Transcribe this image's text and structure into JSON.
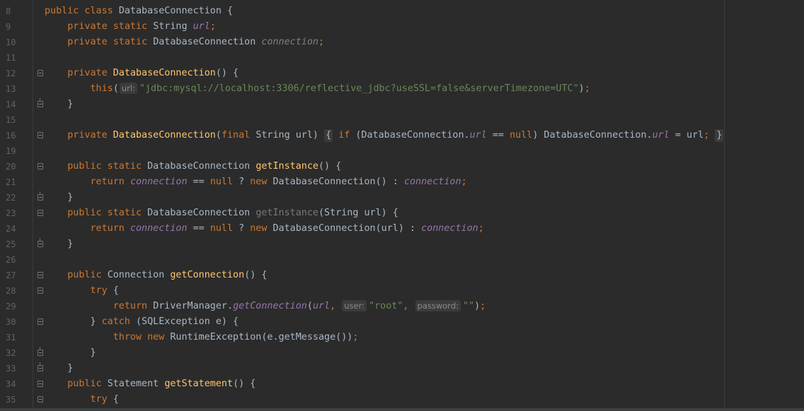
{
  "editor": {
    "lines": [
      {
        "num": "8",
        "tokens": [
          {
            "t": "kw",
            "v": "public class "
          },
          {
            "t": "pl",
            "v": "DatabaseConnection {"
          }
        ]
      },
      {
        "num": "9",
        "tokens": [
          {
            "t": "pl",
            "v": "    "
          },
          {
            "t": "kw",
            "v": "private static "
          },
          {
            "t": "pl",
            "v": "String "
          },
          {
            "t": "fld",
            "v": "url"
          },
          {
            "t": "kw",
            "v": ";"
          }
        ]
      },
      {
        "num": "10",
        "tokens": [
          {
            "t": "pl",
            "v": "    "
          },
          {
            "t": "kw",
            "v": "private static "
          },
          {
            "t": "pl",
            "v": "DatabaseConnection "
          },
          {
            "t": "fldg",
            "v": "connection"
          },
          {
            "t": "kw",
            "v": ";"
          }
        ]
      },
      {
        "num": "11",
        "tokens": []
      },
      {
        "num": "12",
        "fold": "start",
        "tokens": [
          {
            "t": "pl",
            "v": "    "
          },
          {
            "t": "kw",
            "v": "private "
          },
          {
            "t": "fn",
            "v": "DatabaseConnection"
          },
          {
            "t": "pl",
            "v": "() {"
          }
        ]
      },
      {
        "num": "13",
        "tokens": [
          {
            "t": "pl",
            "v": "        "
          },
          {
            "t": "kw",
            "v": "this"
          },
          {
            "t": "pl",
            "v": "("
          },
          {
            "t": "hint",
            "v": "url:"
          },
          {
            "t": "str",
            "v": "\"jdbc:mysql://localhost:3306/reflective_jdbc?useSSL=false&serverTimezone=UTC\""
          },
          {
            "t": "pl",
            "v": ")"
          },
          {
            "t": "kw",
            "v": ";"
          }
        ]
      },
      {
        "num": "14",
        "fold": "end",
        "tokens": [
          {
            "t": "pl",
            "v": "    }"
          }
        ]
      },
      {
        "num": "15",
        "tokens": []
      },
      {
        "num": "16",
        "fold": "start",
        "tokens": [
          {
            "t": "pl",
            "v": "    "
          },
          {
            "t": "kw",
            "v": "private "
          },
          {
            "t": "fn",
            "v": "DatabaseConnection"
          },
          {
            "t": "pl",
            "v": "("
          },
          {
            "t": "kw",
            "v": "final "
          },
          {
            "t": "pl",
            "v": "String url) "
          },
          {
            "t": "box",
            "v": "{"
          },
          {
            "t": "pl",
            "v": " "
          },
          {
            "t": "kw",
            "v": "if "
          },
          {
            "t": "pl",
            "v": "(DatabaseConnection."
          },
          {
            "t": "fld",
            "v": "url"
          },
          {
            "t": "pl",
            "v": " == "
          },
          {
            "t": "kw",
            "v": "null"
          },
          {
            "t": "pl",
            "v": ") DatabaseConnection."
          },
          {
            "t": "fld",
            "v": "url"
          },
          {
            "t": "pl",
            "v": " = url"
          },
          {
            "t": "kw",
            "v": ";"
          },
          {
            "t": "pl",
            "v": " "
          },
          {
            "t": "box",
            "v": "}"
          }
        ]
      },
      {
        "num": "19",
        "tokens": []
      },
      {
        "num": "20",
        "fold": "start",
        "tokens": [
          {
            "t": "pl",
            "v": "    "
          },
          {
            "t": "kw",
            "v": "public static "
          },
          {
            "t": "pl",
            "v": "DatabaseConnection "
          },
          {
            "t": "fn",
            "v": "getInstance"
          },
          {
            "t": "pl",
            "v": "() {"
          }
        ]
      },
      {
        "num": "21",
        "tokens": [
          {
            "t": "pl",
            "v": "        "
          },
          {
            "t": "kw",
            "v": "return "
          },
          {
            "t": "fld",
            "v": "connection"
          },
          {
            "t": "pl",
            "v": " == "
          },
          {
            "t": "kw",
            "v": "null "
          },
          {
            "t": "pl",
            "v": "? "
          },
          {
            "t": "kw",
            "v": "new "
          },
          {
            "t": "pl",
            "v": "DatabaseConnection() : "
          },
          {
            "t": "fld",
            "v": "connection"
          },
          {
            "t": "kw",
            "v": ";"
          }
        ]
      },
      {
        "num": "22",
        "fold": "end",
        "tokens": [
          {
            "t": "pl",
            "v": "    }"
          }
        ]
      },
      {
        "num": "23",
        "fold": "start",
        "tokens": [
          {
            "t": "pl",
            "v": "    "
          },
          {
            "t": "kw",
            "v": "public static "
          },
          {
            "t": "pl",
            "v": "DatabaseConnection "
          },
          {
            "t": "gray",
            "v": "getInstance"
          },
          {
            "t": "pl",
            "v": "(String url) {"
          }
        ]
      },
      {
        "num": "24",
        "tokens": [
          {
            "t": "pl",
            "v": "        "
          },
          {
            "t": "kw",
            "v": "return "
          },
          {
            "t": "fld",
            "v": "connection"
          },
          {
            "t": "pl",
            "v": " == "
          },
          {
            "t": "kw",
            "v": "null "
          },
          {
            "t": "pl",
            "v": "? "
          },
          {
            "t": "kw",
            "v": "new "
          },
          {
            "t": "pl",
            "v": "DatabaseConnection(url) : "
          },
          {
            "t": "fld",
            "v": "connection"
          },
          {
            "t": "kw",
            "v": ";"
          }
        ]
      },
      {
        "num": "25",
        "fold": "end",
        "tokens": [
          {
            "t": "pl",
            "v": "    }"
          }
        ]
      },
      {
        "num": "26",
        "tokens": []
      },
      {
        "num": "27",
        "fold": "start",
        "tokens": [
          {
            "t": "pl",
            "v": "    "
          },
          {
            "t": "kw",
            "v": "public "
          },
          {
            "t": "pl",
            "v": "Connection "
          },
          {
            "t": "fn",
            "v": "getConnection"
          },
          {
            "t": "pl",
            "v": "() {"
          }
        ]
      },
      {
        "num": "28",
        "fold": "start",
        "tokens": [
          {
            "t": "pl",
            "v": "        "
          },
          {
            "t": "kw",
            "v": "try "
          },
          {
            "t": "pl",
            "v": "{"
          }
        ]
      },
      {
        "num": "29",
        "tokens": [
          {
            "t": "pl",
            "v": "            "
          },
          {
            "t": "kw",
            "v": "return "
          },
          {
            "t": "pl",
            "v": "DriverManager."
          },
          {
            "t": "it",
            "v": "getConnection"
          },
          {
            "t": "pl",
            "v": "("
          },
          {
            "t": "fld",
            "v": "url"
          },
          {
            "t": "kw",
            "v": ", "
          },
          {
            "t": "hint",
            "v": "user:"
          },
          {
            "t": "str",
            "v": "\"root\""
          },
          {
            "t": "kw",
            "v": ", "
          },
          {
            "t": "hint",
            "v": "password:"
          },
          {
            "t": "str",
            "v": "\"\""
          },
          {
            "t": "pl",
            "v": ")"
          },
          {
            "t": "kw",
            "v": ";"
          }
        ]
      },
      {
        "num": "30",
        "fold": "start",
        "tokens": [
          {
            "t": "pl",
            "v": "        } "
          },
          {
            "t": "kw",
            "v": "catch "
          },
          {
            "t": "pl",
            "v": "(SQLException e) {"
          }
        ]
      },
      {
        "num": "31",
        "tokens": [
          {
            "t": "pl",
            "v": "            "
          },
          {
            "t": "kw",
            "v": "throw new "
          },
          {
            "t": "pl",
            "v": "RuntimeException(e.getMessage())"
          },
          {
            "t": "kw",
            "v": ";"
          }
        ]
      },
      {
        "num": "32",
        "fold": "end",
        "tokens": [
          {
            "t": "pl",
            "v": "        }"
          }
        ]
      },
      {
        "num": "33",
        "fold": "end",
        "tokens": [
          {
            "t": "pl",
            "v": "    }"
          }
        ]
      },
      {
        "num": "34",
        "fold": "start",
        "tokens": [
          {
            "t": "pl",
            "v": "    "
          },
          {
            "t": "kw",
            "v": "public "
          },
          {
            "t": "pl",
            "v": "Statement "
          },
          {
            "t": "fn",
            "v": "getStatement"
          },
          {
            "t": "pl",
            "v": "() {"
          }
        ]
      },
      {
        "num": "35",
        "fold": "start",
        "tokens": [
          {
            "t": "pl",
            "v": "        "
          },
          {
            "t": "kw",
            "v": "try "
          },
          {
            "t": "pl",
            "v": "{"
          }
        ]
      }
    ]
  },
  "colors": {
    "background": "#2b2b2b",
    "keyword": "#cc7832",
    "method": "#ffc66d",
    "field": "#9876aa",
    "string": "#6a8759",
    "plain": "#a9b7c6",
    "line_number": "#606366"
  }
}
